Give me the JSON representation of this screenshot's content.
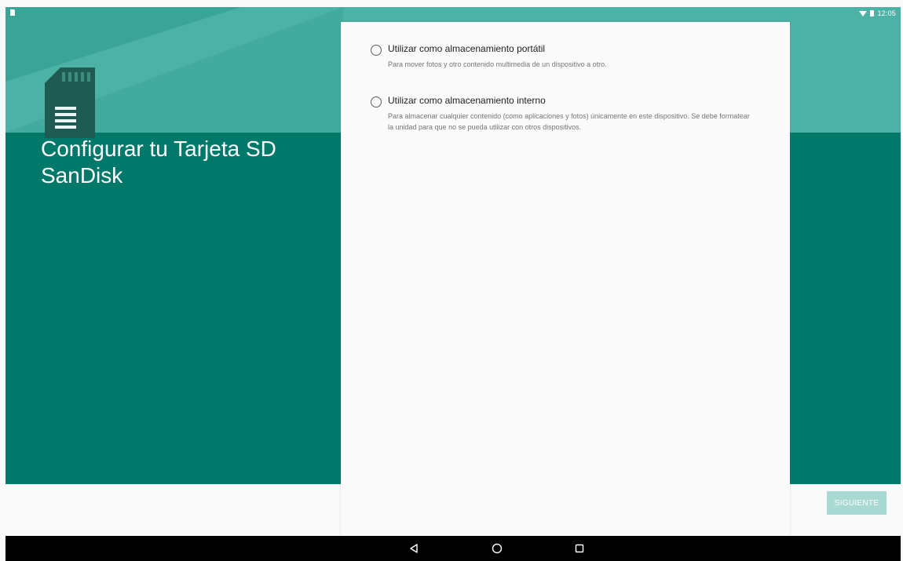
{
  "status_bar": {
    "time": "12:05",
    "icons": [
      "sd-card-icon",
      "wifi-icon",
      "battery-icon"
    ]
  },
  "header": {
    "title": "Configurar tu Tarjeta SD SanDisk",
    "illustration": "sd-card-icon"
  },
  "options": [
    {
      "title": "Utilizar como almacenamiento portátil",
      "description": "Para mover fotos y otro contenido multimedia de un dispositivo a otro.",
      "selected": false
    },
    {
      "title": "Utilizar como almacenamiento interno",
      "description": "Para almacenar cualquier contenido (como aplicaciones y fotos) únicamente en este dispositivo. Se debe formatear la unidad para que no se pueda utilizar con otros dispositivos.",
      "selected": false
    }
  ],
  "footer": {
    "next_label": "SIGUIENTE",
    "next_enabled": false
  },
  "nav_bar": {
    "buttons": [
      "back-icon",
      "home-icon",
      "recents-icon"
    ]
  },
  "colors": {
    "header_light": "#4cb2a6",
    "header_dark": "#00796b",
    "button_disabled": "#a9d9d3",
    "background": "#fafafa"
  }
}
